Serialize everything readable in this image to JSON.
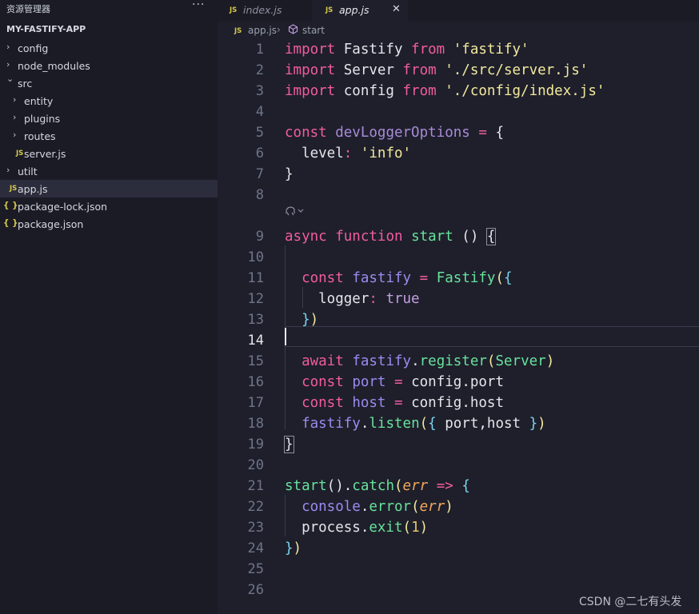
{
  "explorer": {
    "title": "资源管理器",
    "more": "···",
    "project": "MY-FASTIFY-APP",
    "items": [
      {
        "label": "config",
        "kind": "folder",
        "expanded": false
      },
      {
        "label": "node_modules",
        "kind": "folder",
        "expanded": false
      },
      {
        "label": "src",
        "kind": "folder",
        "expanded": true
      },
      {
        "label": "entity",
        "kind": "folder",
        "expanded": false
      },
      {
        "label": "plugins",
        "kind": "folder",
        "expanded": false
      },
      {
        "label": "routes",
        "kind": "folder",
        "expanded": false
      },
      {
        "label": "server.js",
        "kind": "js"
      },
      {
        "label": "utilt",
        "kind": "folder",
        "expanded": false
      },
      {
        "label": "app.js",
        "kind": "js",
        "active": true
      },
      {
        "label": "package-lock.json",
        "kind": "json"
      },
      {
        "label": "package.json",
        "kind": "json"
      }
    ],
    "js_badge": "JS",
    "json_badge": "{ }"
  },
  "tabs": [
    {
      "label": "index.js",
      "active": false
    },
    {
      "label": "app.js",
      "active": true,
      "close": "✕"
    }
  ],
  "breadcrumb": {
    "file": "app.js",
    "separator": "›",
    "symbol": "start"
  },
  "editor": {
    "current_line": 14,
    "line_numbers": [
      "1",
      "2",
      "3",
      "4",
      "5",
      "6",
      "7",
      "8",
      "9",
      "10",
      "11",
      "12",
      "13",
      "14",
      "15",
      "16",
      "17",
      "18",
      "19",
      "20",
      "21",
      "22",
      "23",
      "24",
      "25",
      "26"
    ],
    "codelens_icon": "copilot-icon",
    "lines": [
      [
        {
          "t": "import",
          "c": "kw"
        },
        {
          "t": " Fastify ",
          "c": "plain"
        },
        {
          "t": "from",
          "c": "kw"
        },
        {
          "t": " ",
          "c": "plain"
        },
        {
          "t": "'fastify'",
          "c": "str"
        }
      ],
      [
        {
          "t": "import",
          "c": "kw"
        },
        {
          "t": " Server ",
          "c": "plain"
        },
        {
          "t": "from",
          "c": "kw"
        },
        {
          "t": " ",
          "c": "plain"
        },
        {
          "t": "'./src/server.js'",
          "c": "str"
        }
      ],
      [
        {
          "t": "import",
          "c": "kw"
        },
        {
          "t": " config ",
          "c": "plain"
        },
        {
          "t": "from",
          "c": "kw"
        },
        {
          "t": " ",
          "c": "plain"
        },
        {
          "t": "'./config/index.js'",
          "c": "str"
        }
      ],
      [],
      [
        {
          "t": "const",
          "c": "kw"
        },
        {
          "t": " ",
          "c": "plain"
        },
        {
          "t": "devLoggerOptions",
          "c": "dim"
        },
        {
          "t": " ",
          "c": "plain"
        },
        {
          "t": "=",
          "c": "kw"
        },
        {
          "t": " ",
          "c": "plain"
        },
        {
          "t": "{",
          "c": "plain"
        }
      ],
      [
        {
          "t": "  level",
          "c": "plain"
        },
        {
          "t": ":",
          "c": "kw"
        },
        {
          "t": " ",
          "c": "plain"
        },
        {
          "t": "'info'",
          "c": "str"
        }
      ],
      [
        {
          "t": "}",
          "c": "plain"
        }
      ],
      [],
      [
        {
          "t": "async",
          "c": "kw"
        },
        {
          "t": " ",
          "c": "plain"
        },
        {
          "t": "function",
          "c": "kw"
        },
        {
          "t": " ",
          "c": "plain"
        },
        {
          "t": "start",
          "c": "fn"
        },
        {
          "t": " () ",
          "c": "plain"
        },
        {
          "t": "{",
          "c": "plain",
          "box": true
        }
      ],
      [],
      [
        {
          "t": "  ",
          "c": "plain"
        },
        {
          "t": "const",
          "c": "kw"
        },
        {
          "t": " ",
          "c": "plain"
        },
        {
          "t": "fastify",
          "c": "prop"
        },
        {
          "t": " ",
          "c": "plain"
        },
        {
          "t": "=",
          "c": "kw"
        },
        {
          "t": " ",
          "c": "plain"
        },
        {
          "t": "Fastify",
          "c": "fn"
        },
        {
          "t": "(",
          "c": "brk1"
        },
        {
          "t": "{",
          "c": "brk2"
        }
      ],
      [
        {
          "t": "    logger",
          "c": "plain"
        },
        {
          "t": ":",
          "c": "kw"
        },
        {
          "t": " ",
          "c": "plain"
        },
        {
          "t": "true",
          "c": "bool"
        }
      ],
      [
        {
          "t": "  ",
          "c": "plain"
        },
        {
          "t": "}",
          "c": "brk2"
        },
        {
          "t": ")",
          "c": "brk1"
        }
      ],
      [],
      [
        {
          "t": "  ",
          "c": "plain"
        },
        {
          "t": "await",
          "c": "kw"
        },
        {
          "t": " ",
          "c": "plain"
        },
        {
          "t": "fastify",
          "c": "prop"
        },
        {
          "t": ".",
          "c": "plain"
        },
        {
          "t": "register",
          "c": "fn"
        },
        {
          "t": "(",
          "c": "brk1"
        },
        {
          "t": "Server",
          "c": "fn"
        },
        {
          "t": ")",
          "c": "brk1"
        }
      ],
      [
        {
          "t": "  ",
          "c": "plain"
        },
        {
          "t": "const",
          "c": "kw"
        },
        {
          "t": " ",
          "c": "plain"
        },
        {
          "t": "port",
          "c": "prop"
        },
        {
          "t": " ",
          "c": "plain"
        },
        {
          "t": "=",
          "c": "kw"
        },
        {
          "t": " config.port",
          "c": "plain"
        }
      ],
      [
        {
          "t": "  ",
          "c": "plain"
        },
        {
          "t": "const",
          "c": "kw"
        },
        {
          "t": " ",
          "c": "plain"
        },
        {
          "t": "host",
          "c": "prop"
        },
        {
          "t": " ",
          "c": "plain"
        },
        {
          "t": "=",
          "c": "kw"
        },
        {
          "t": " config.host",
          "c": "plain"
        }
      ],
      [
        {
          "t": "  ",
          "c": "plain"
        },
        {
          "t": "fastify",
          "c": "prop"
        },
        {
          "t": ".",
          "c": "plain"
        },
        {
          "t": "listen",
          "c": "fn"
        },
        {
          "t": "(",
          "c": "brk1"
        },
        {
          "t": "{",
          "c": "brk2"
        },
        {
          "t": " port,host ",
          "c": "plain"
        },
        {
          "t": "}",
          "c": "brk2"
        },
        {
          "t": ")",
          "c": "brk1"
        }
      ],
      [
        {
          "t": "}",
          "c": "plain",
          "box": true
        }
      ],
      [],
      [
        {
          "t": "start",
          "c": "fn"
        },
        {
          "t": "().",
          "c": "plain"
        },
        {
          "t": "catch",
          "c": "fn"
        },
        {
          "t": "(",
          "c": "brk1"
        },
        {
          "t": "err",
          "c": "param"
        },
        {
          "t": " ",
          "c": "plain"
        },
        {
          "t": "=>",
          "c": "kw"
        },
        {
          "t": " ",
          "c": "plain"
        },
        {
          "t": "{",
          "c": "brk2"
        }
      ],
      [
        {
          "t": "  ",
          "c": "plain"
        },
        {
          "t": "console",
          "c": "prop"
        },
        {
          "t": ".",
          "c": "plain"
        },
        {
          "t": "error",
          "c": "fn"
        },
        {
          "t": "(",
          "c": "brk1"
        },
        {
          "t": "err",
          "c": "param"
        },
        {
          "t": ")",
          "c": "brk1"
        }
      ],
      [
        {
          "t": "  process.",
          "c": "plain"
        },
        {
          "t": "exit",
          "c": "fn"
        },
        {
          "t": "(",
          "c": "brk1"
        },
        {
          "t": "1",
          "c": "num"
        },
        {
          "t": ")",
          "c": "brk1"
        }
      ],
      [
        {
          "t": "}",
          "c": "brk2"
        },
        {
          "t": ")",
          "c": "brk1"
        }
      ],
      [],
      []
    ]
  },
  "watermark": "CSDN @二七有头发",
  "colors": {
    "keyword": "#f25c9e",
    "function": "#68e29c",
    "string": "#f3e99d",
    "variable": "#9b8bf0",
    "background": "#1e1f2b",
    "sidebar": "#1a1b25"
  }
}
